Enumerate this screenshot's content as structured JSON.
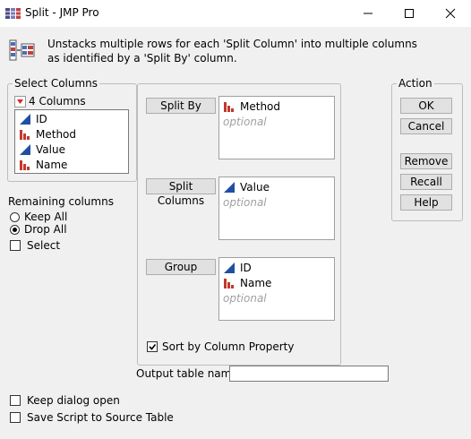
{
  "window": {
    "title": "Split - JMP Pro"
  },
  "description": "Unstacks multiple rows for each 'Split Column' into multiple columns as identified by a 'Split By' column.",
  "select_columns": {
    "legend": "Select Columns",
    "count_label": "4 Columns",
    "items": [
      {
        "name": "ID",
        "icon": "continuous-icon"
      },
      {
        "name": "Method",
        "icon": "nominal-icon"
      },
      {
        "name": "Value",
        "icon": "continuous-icon"
      },
      {
        "name": "Name",
        "icon": "nominal-icon"
      }
    ]
  },
  "remaining": {
    "label": "Remaining columns",
    "options": [
      "Keep All",
      "Drop All"
    ],
    "selected": "Drop All",
    "select_label": "Select"
  },
  "roles": {
    "split_by": {
      "button": "Split By",
      "items": [
        {
          "name": "Method",
          "icon": "nominal-icon"
        }
      ],
      "optional": "optional"
    },
    "split_columns": {
      "button": "Split Columns",
      "items": [
        {
          "name": "Value",
          "icon": "continuous-icon"
        }
      ],
      "optional": "optional"
    },
    "group": {
      "button": "Group",
      "items": [
        {
          "name": "ID",
          "icon": "continuous-icon"
        },
        {
          "name": "Name",
          "icon": "nominal-icon"
        }
      ],
      "optional": "optional"
    },
    "sort_label": "Sort by Column Property"
  },
  "action": {
    "legend": "Action",
    "ok": "OK",
    "cancel": "Cancel",
    "remove": "Remove",
    "recall": "Recall",
    "help": "Help"
  },
  "output": {
    "label": "Output table name:",
    "value": ""
  },
  "bottom": {
    "keep_open": "Keep dialog open",
    "save_script": "Save Script to Source Table"
  },
  "colors": {
    "nominal": "#c0392b",
    "continuous": "#1f4fa3",
    "arrow": "#d9262a"
  }
}
